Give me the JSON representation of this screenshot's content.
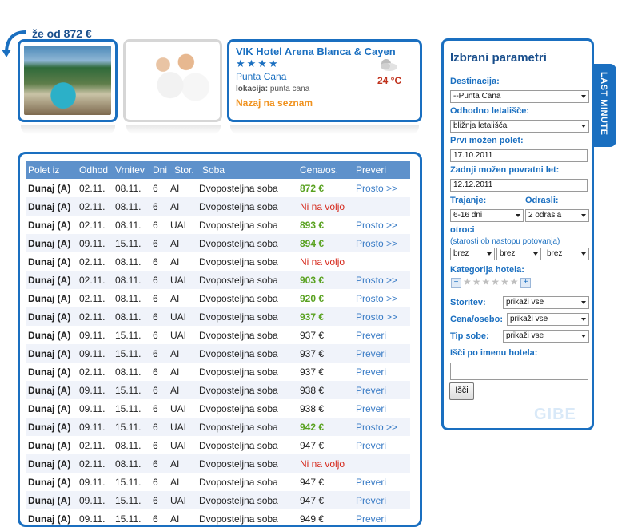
{
  "teaser": {
    "text": "že od 872 €"
  },
  "hotel": {
    "name": "VIK Hotel Arena Blanca & Cayen",
    "stars": "★★★★",
    "city": "Punta Cana",
    "location_label": "lokacija:",
    "location_value": "punta cana",
    "back_link": "Nazaj na seznam",
    "temperature": "24 °C"
  },
  "table": {
    "headers": [
      "Polet iz",
      "Odhod",
      "Vrnitev",
      "Dni",
      "Stor.",
      "Soba",
      "Cena/os.",
      "Preveri"
    ],
    "rows": [
      {
        "from": "Dunaj (A)",
        "dep": "02.11.",
        "ret": "08.11.",
        "days": "6",
        "svc": "AI",
        "room": "Dvoposteljna soba",
        "price": "872 €",
        "pclass": "green",
        "action": "Prosto >>"
      },
      {
        "from": "Dunaj (A)",
        "dep": "02.11.",
        "ret": "08.11.",
        "days": "6",
        "svc": "AI",
        "room": "Dvoposteljna soba",
        "price": "Ni na voljo",
        "pclass": "red",
        "action": ""
      },
      {
        "from": "Dunaj (A)",
        "dep": "02.11.",
        "ret": "08.11.",
        "days": "6",
        "svc": "UAI",
        "room": "Dvoposteljna soba",
        "price": "893 €",
        "pclass": "green",
        "action": "Prosto >>"
      },
      {
        "from": "Dunaj (A)",
        "dep": "09.11.",
        "ret": "15.11.",
        "days": "6",
        "svc": "AI",
        "room": "Dvoposteljna soba",
        "price": "894 €",
        "pclass": "green",
        "action": "Prosto >>"
      },
      {
        "from": "Dunaj (A)",
        "dep": "02.11.",
        "ret": "08.11.",
        "days": "6",
        "svc": "AI",
        "room": "Dvoposteljna soba",
        "price": "Ni na voljo",
        "pclass": "red",
        "action": ""
      },
      {
        "from": "Dunaj (A)",
        "dep": "02.11.",
        "ret": "08.11.",
        "days": "6",
        "svc": "UAI",
        "room": "Dvoposteljna soba",
        "price": "903 €",
        "pclass": "green",
        "action": "Prosto >>"
      },
      {
        "from": "Dunaj (A)",
        "dep": "02.11.",
        "ret": "08.11.",
        "days": "6",
        "svc": "AI",
        "room": "Dvoposteljna soba",
        "price": "920 €",
        "pclass": "green",
        "action": "Prosto >>"
      },
      {
        "from": "Dunaj (A)",
        "dep": "02.11.",
        "ret": "08.11.",
        "days": "6",
        "svc": "UAI",
        "room": "Dvoposteljna soba",
        "price": "937 €",
        "pclass": "green",
        "action": "Prosto >>"
      },
      {
        "from": "Dunaj (A)",
        "dep": "09.11.",
        "ret": "15.11.",
        "days": "6",
        "svc": "UAI",
        "room": "Dvoposteljna soba",
        "price": "937 €",
        "pclass": "normal",
        "action": "Preveri"
      },
      {
        "from": "Dunaj (A)",
        "dep": "09.11.",
        "ret": "15.11.",
        "days": "6",
        "svc": "AI",
        "room": "Dvoposteljna soba",
        "price": "937 €",
        "pclass": "normal",
        "action": "Preveri"
      },
      {
        "from": "Dunaj (A)",
        "dep": "02.11.",
        "ret": "08.11.",
        "days": "6",
        "svc": "AI",
        "room": "Dvoposteljna soba",
        "price": "937 €",
        "pclass": "normal",
        "action": "Preveri"
      },
      {
        "from": "Dunaj (A)",
        "dep": "09.11.",
        "ret": "15.11.",
        "days": "6",
        "svc": "AI",
        "room": "Dvoposteljna soba",
        "price": "938 €",
        "pclass": "normal",
        "action": "Preveri"
      },
      {
        "from": "Dunaj (A)",
        "dep": "09.11.",
        "ret": "15.11.",
        "days": "6",
        "svc": "UAI",
        "room": "Dvoposteljna soba",
        "price": "938 €",
        "pclass": "normal",
        "action": "Preveri"
      },
      {
        "from": "Dunaj (A)",
        "dep": "09.11.",
        "ret": "15.11.",
        "days": "6",
        "svc": "UAI",
        "room": "Dvoposteljna soba",
        "price": "942 €",
        "pclass": "green",
        "action": "Prosto >>"
      },
      {
        "from": "Dunaj (A)",
        "dep": "02.11.",
        "ret": "08.11.",
        "days": "6",
        "svc": "UAI",
        "room": "Dvoposteljna soba",
        "price": "947 €",
        "pclass": "normal",
        "action": "Preveri"
      },
      {
        "from": "Dunaj (A)",
        "dep": "02.11.",
        "ret": "08.11.",
        "days": "6",
        "svc": "AI",
        "room": "Dvoposteljna soba",
        "price": "Ni na voljo",
        "pclass": "red",
        "action": ""
      },
      {
        "from": "Dunaj (A)",
        "dep": "09.11.",
        "ret": "15.11.",
        "days": "6",
        "svc": "AI",
        "room": "Dvoposteljna soba",
        "price": "947 €",
        "pclass": "normal",
        "action": "Preveri"
      },
      {
        "from": "Dunaj (A)",
        "dep": "09.11.",
        "ret": "15.11.",
        "days": "6",
        "svc": "UAI",
        "room": "Dvoposteljna soba",
        "price": "947 €",
        "pclass": "normal",
        "action": "Preveri"
      },
      {
        "from": "Dunaj (A)",
        "dep": "09.11.",
        "ret": "15.11.",
        "days": "6",
        "svc": "AI",
        "room": "Dvoposteljna soba",
        "price": "949 €",
        "pclass": "normal",
        "action": "Preveri"
      }
    ]
  },
  "sidebar": {
    "title": "Izbrani parametri",
    "destination_label": "Destinacija:",
    "destination_value": "--Punta Cana",
    "airport_label": "Odhodno letališče:",
    "airport_value": "bližnja letališča",
    "first_flight_label": "Prvi možen polet:",
    "first_flight_value": "17.10.2011",
    "last_return_label": "Zadnji možen povratni let:",
    "last_return_value": "12.12.2011",
    "duration_label": "Trajanje:",
    "duration_value": "6-16 dni",
    "adults_label": "Odrasli:",
    "adults_value": "2 odrasla",
    "children_label": "otroci",
    "children_hint": "(starosti ob nastopu potovanja)",
    "child1": "brez",
    "child2": "brez",
    "child3": "brez",
    "category_label": "Kategorija hotela:",
    "category_stars": "★★★★★★",
    "services_label": "Storitev:",
    "services_value": "prikaži vse",
    "price_label": "Cena/osebo:",
    "price_value": "prikaži vse",
    "room_label": "Tip sobe:",
    "room_value": "prikaži vse",
    "hotel_search_label": "Išči po imenu hotela:",
    "hotel_search_value": "",
    "search_button": "Išči",
    "watermark": "GIBE"
  },
  "last_minute": {
    "label": "LAST MINUTE"
  },
  "colors": {
    "accent": "#1a6fc0",
    "header": "#5e91cb",
    "available": "#58a11f",
    "unavailable": "#d62a1d",
    "back_link": "#f0921e"
  }
}
